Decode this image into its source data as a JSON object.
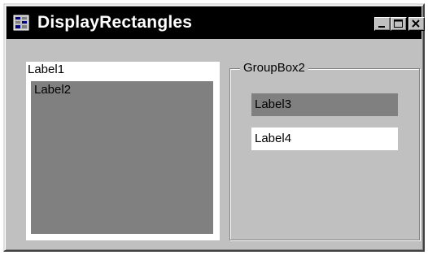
{
  "window": {
    "title": "DisplayRectangles",
    "icon": "form-window-icon",
    "controls": [
      "minimize-icon",
      "maximize-icon",
      "close-icon"
    ]
  },
  "label1": {
    "text": "Label1"
  },
  "label2": {
    "text": "Label2"
  },
  "groupbox": {
    "title": "GroupBox2"
  },
  "label3": {
    "text": "Label3"
  },
  "label4": {
    "text": "Label4"
  },
  "colors": {
    "titlebar": "#000000",
    "face": "#c0c0c0",
    "shadow": "#808080",
    "highlight": "#ffffff"
  }
}
